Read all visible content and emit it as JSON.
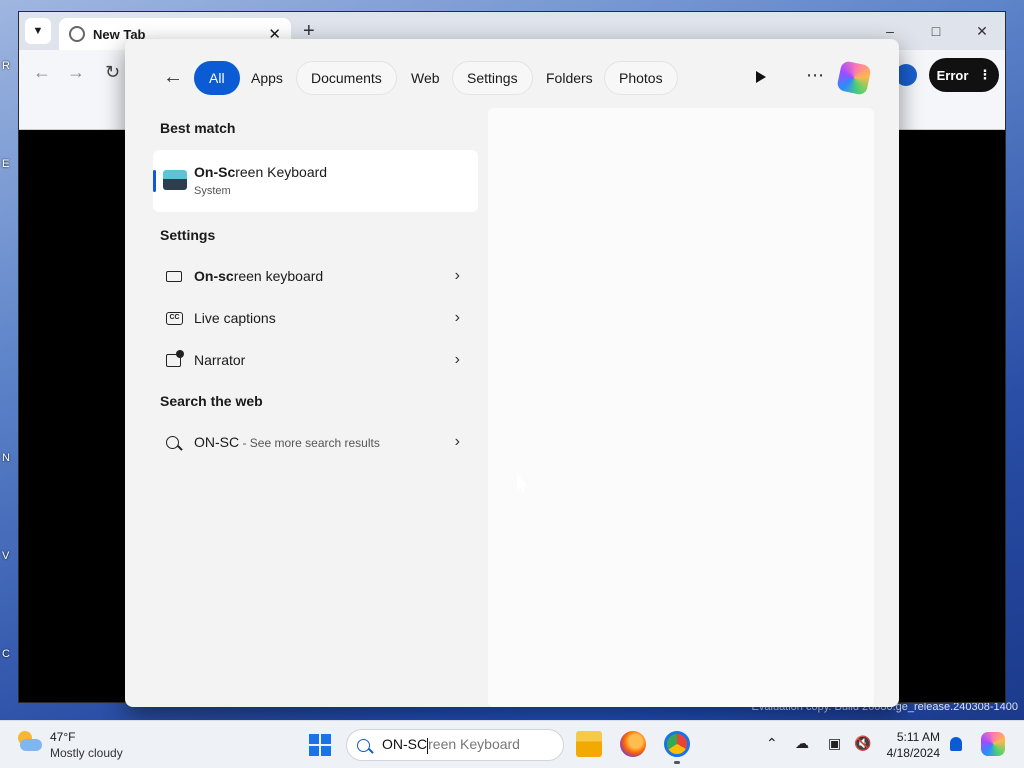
{
  "browser": {
    "tab_title": "New Tab",
    "error_label": "Error"
  },
  "search_panel": {
    "filters": [
      {
        "label": "All",
        "active": true
      },
      {
        "label": "Apps"
      },
      {
        "label": "Documents"
      },
      {
        "label": "Web"
      },
      {
        "label": "Settings"
      },
      {
        "label": "Folders"
      },
      {
        "label": "Photos"
      }
    ],
    "best_match_heading": "Best match",
    "best_match": {
      "title_bold": "On-Sc",
      "title_rest": "reen Keyboard",
      "subtitle": "System",
      "icon": "on-screen-keyboard-app-icon"
    },
    "settings_heading": "Settings",
    "settings_items": [
      {
        "label_bold": "On-sc",
        "label_rest": "reen keyboard",
        "icon": "keyboard-icon"
      },
      {
        "label": "Live captions",
        "icon": "closed-captions-icon"
      },
      {
        "label": "Narrator",
        "icon": "narrator-icon"
      }
    ],
    "web_heading": "Search the web",
    "web_item": {
      "query": "ON-SC",
      "suffix": " - See more search results"
    }
  },
  "desktop": {
    "watermark_line1": "Evaluation copy. Build 26080.ge_release.240308-1400"
  },
  "taskbar": {
    "weather": {
      "temp": "47°F",
      "condition": "Mostly cloudy"
    },
    "search_typed": "ON-SC",
    "search_autocomplete": "reen Keyboard",
    "time": "5:11 AM",
    "date": "4/18/2024"
  },
  "colors": {
    "accent": "#0a5bd4"
  }
}
